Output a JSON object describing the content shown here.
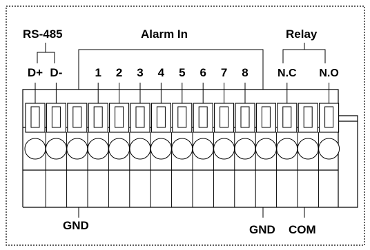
{
  "diagram": {
    "group_labels": {
      "rs485": "RS-485",
      "alarm_in": "Alarm In",
      "relay": "Relay"
    },
    "pin_labels": [
      "D+",
      "D-",
      "1",
      "2",
      "3",
      "4",
      "5",
      "6",
      "7",
      "8",
      "N.C",
      "N.O"
    ],
    "bottom_labels": {
      "gnd_left": "GND",
      "gnd_right": "GND",
      "com": "COM"
    },
    "colors": {
      "line": "#000000",
      "terminal_fill": "#ffffff",
      "background": "#ffffff"
    }
  }
}
